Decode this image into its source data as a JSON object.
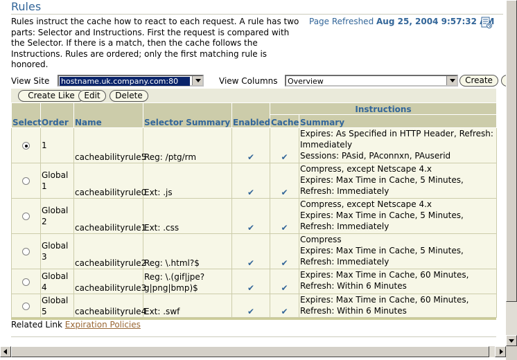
{
  "page": {
    "title": "Rules",
    "description": "Rules instruct the cache how to react to each request. A rule has two parts: Selector and Instructions. First the request is compared with the Selector. If there is a match, then the cache follows the Instructions. Rules are ordered; only the first matching rule is honored.",
    "refresh_label": "Page Refreshed",
    "refresh_time": "Aug 25, 2004 9:57:32 AM"
  },
  "controls": {
    "view_site_label": "View Site",
    "view_site_value": "hostname.uk.company.com:80",
    "view_columns_label": "View Columns",
    "view_columns_value": "Overview",
    "create_label": "Create"
  },
  "toolbar": {
    "create_like": "Create Like",
    "edit": "Edit",
    "delete": "Delete"
  },
  "table": {
    "group_header": "Instructions",
    "headers": {
      "select": "Select",
      "order": "Order",
      "name": "Name",
      "selector": "Selector Summary",
      "enabled": "Enabled",
      "cache": "Cache",
      "summary": "Summary"
    },
    "check_glyph": "✔",
    "rows": [
      {
        "selected": true,
        "order": "1",
        "name": "cacheabilityrule5",
        "selector": "Reg: /ptg/rm",
        "enabled": true,
        "cache": true,
        "summary": [
          "Expires: As Specified in HTTP Header, Refresh: Immediately",
          "Sessions: PAsid, PAconnxn, PAuserid"
        ]
      },
      {
        "selected": false,
        "order": "Global 1",
        "name": "cacheabilityrule0",
        "selector": "Ext: .js",
        "enabled": true,
        "cache": true,
        "summary": [
          "Compress, except Netscape 4.x",
          "Expires: Max Time in Cache, 5 Minutes, Refresh: Immediately"
        ]
      },
      {
        "selected": false,
        "order": "Global 2",
        "name": "cacheabilityrule1",
        "selector": "Ext: .css",
        "enabled": true,
        "cache": true,
        "summary": [
          "Compress, except Netscape 4.x",
          "Expires: Max Time in Cache, 5 Minutes, Refresh: Immediately"
        ]
      },
      {
        "selected": false,
        "order": "Global 3",
        "name": "cacheabilityrule2",
        "selector": "Reg: \\.html?$",
        "enabled": true,
        "cache": true,
        "summary": [
          "Compress",
          "Expires: Max Time in Cache, 5 Minutes, Refresh: Immediately"
        ]
      },
      {
        "selected": false,
        "order": "Global 4",
        "name": "cacheabilityrule3",
        "selector": "Reg: \\.(gif|jpe?g|png|bmp)$",
        "enabled": true,
        "cache": true,
        "summary": [
          "Expires: Max Time in Cache, 60 Minutes, Refresh: Within 6 Minutes"
        ]
      },
      {
        "selected": false,
        "order": "Global 5",
        "name": "cacheabilityrule4",
        "selector": "Ext: .swf",
        "enabled": true,
        "cache": true,
        "summary": [
          "Expires: Max Time in Cache, 60 Minutes, Refresh: Within 6 Minutes"
        ]
      }
    ]
  },
  "related": {
    "label": "Related Link",
    "link": "Expiration Policies"
  },
  "colors": {
    "title": "#336699",
    "header_bg": "#ccccaa",
    "row_bg": "#f7f7e7",
    "link": "#996633"
  }
}
